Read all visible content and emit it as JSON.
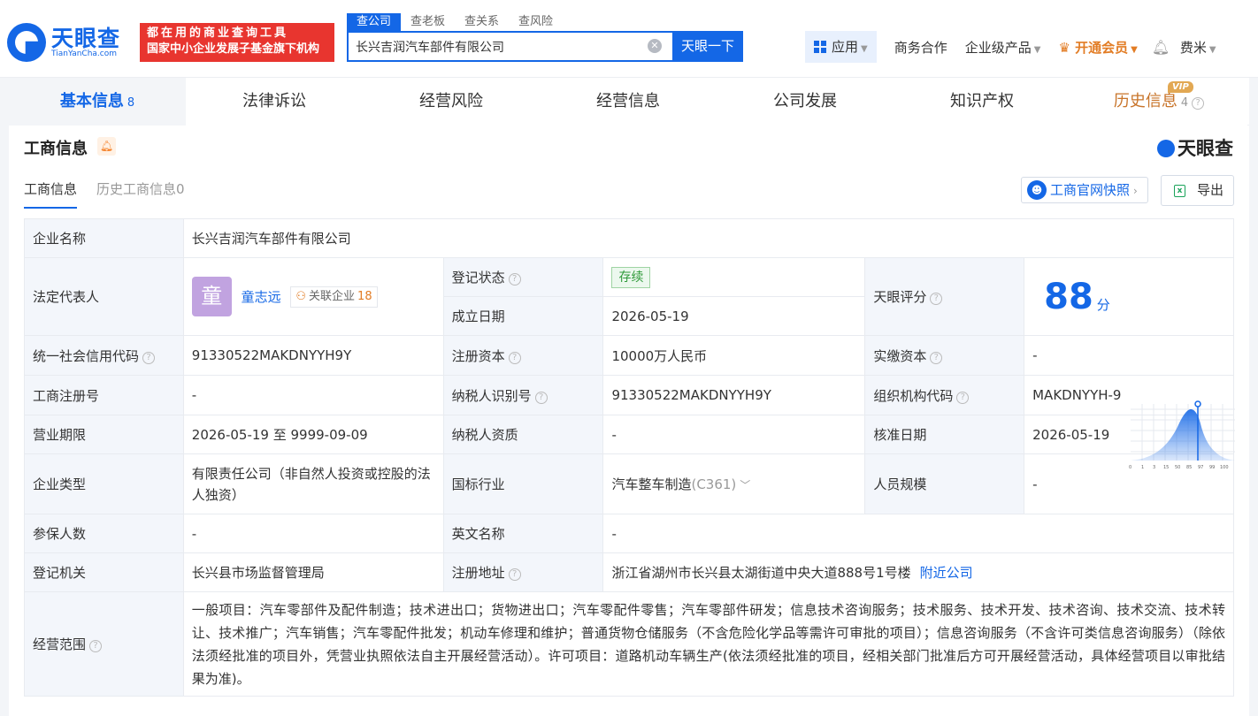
{
  "header": {
    "logo_text": "天眼查",
    "logo_sub": "TianYanCha.com",
    "slogan_line1": "都在用的商业查询工具",
    "slogan_line2": "国家中小企业发展子基金旗下机构",
    "search_tabs": [
      "查公司",
      "查老板",
      "查关系",
      "查风险"
    ],
    "search_value": "长兴吉润汽车部件有限公司",
    "search_button": "天眼一下",
    "nav": {
      "app": "应用",
      "biz": "商务合作",
      "enterprise": "企业级产品",
      "vip": "开通会员",
      "user": "费米"
    }
  },
  "tabs": [
    {
      "label": "基本信息",
      "count": "8"
    },
    {
      "label": "法律诉讼",
      "count": ""
    },
    {
      "label": "经营风险",
      "count": ""
    },
    {
      "label": "经营信息",
      "count": ""
    },
    {
      "label": "公司发展",
      "count": ""
    },
    {
      "label": "知识产权",
      "count": ""
    },
    {
      "label": "历史信息",
      "count": "4"
    }
  ],
  "vip_badge": "VIP",
  "section": {
    "title": "工商信息",
    "brand": "天眼查",
    "subtabs": [
      "工商信息",
      "历史工商信息0"
    ],
    "snapshot_button": "工商官网快照",
    "export_button": "导出"
  },
  "info": {
    "company_name_label": "企业名称",
    "company_name": "长兴吉润汽车部件有限公司",
    "legal_rep_label": "法定代表人",
    "legal_rep_avatar": "童",
    "legal_rep": "童志远",
    "related_label": "关联企业",
    "related_count": "18",
    "reg_status_label": "登记状态",
    "reg_status": "存续",
    "found_date_label": "成立日期",
    "found_date": "2026-05-19",
    "score_label": "天眼评分",
    "score": "88",
    "score_unit": "分",
    "score_axis": [
      "0",
      "1",
      "3",
      "15",
      "50",
      "85",
      "97",
      "99",
      "100"
    ],
    "credit_code_label": "统一社会信用代码",
    "credit_code": "91330522MAKDNYYH9Y",
    "reg_capital_label": "注册资本",
    "reg_capital": "10000万人民币",
    "paid_capital_label": "实缴资本",
    "paid_capital": "-",
    "reg_no_label": "工商注册号",
    "reg_no": "-",
    "taxpayer_id_label": "纳税人识别号",
    "taxpayer_id": "91330522MAKDNYYH9Y",
    "org_code_label": "组织机构代码",
    "org_code": "MAKDNYYH-9",
    "term_label": "营业期限",
    "term": "2026-05-19 至 9999-09-09",
    "taxpayer_qual_label": "纳税人资质",
    "taxpayer_qual": "-",
    "approve_date_label": "核准日期",
    "approve_date": "2026-05-19",
    "type_label": "企业类型",
    "type": "有限责任公司（非自然人投资或控股的法人独资）",
    "industry_label": "国标行业",
    "industry": "汽车整车制造",
    "industry_code": "(C361)",
    "staff_label": "人员规模",
    "staff": "-",
    "insured_label": "参保人数",
    "insured": "-",
    "en_name_label": "英文名称",
    "en_name": "-",
    "authority_label": "登记机关",
    "authority": "长兴县市场监督管理局",
    "address_label": "注册地址",
    "address": "浙江省湖州市长兴县太湖街道中央大道888号1号楼",
    "nearby_link": "附近公司",
    "scope_label": "经营范围",
    "scope": "一般项目：汽车零部件及配件制造；技术进出口；货物进出口；汽车零配件零售；汽车零部件研发；信息技术咨询服务；技术服务、技术开发、技术咨询、技术交流、技术转让、技术推广；汽车销售；汽车零配件批发；机动车修理和维护；普通货物仓储服务（不含危险化学品等需许可审批的项目）；信息咨询服务（不含许可类信息咨询服务）（除依法须经批准的项目外，凭营业执照依法自主开展经营活动）。许可项目：道路机动车辆生产(依法须经批准的项目，经相关部门批准后方可开展经营活动，具体经营项目以审批结果为准)。"
  },
  "colors": {
    "brand_blue": "#1467e6",
    "slogan_red": "#e8352f",
    "vip_orange": "#e27c24",
    "status_green": "#2f9a3a"
  }
}
